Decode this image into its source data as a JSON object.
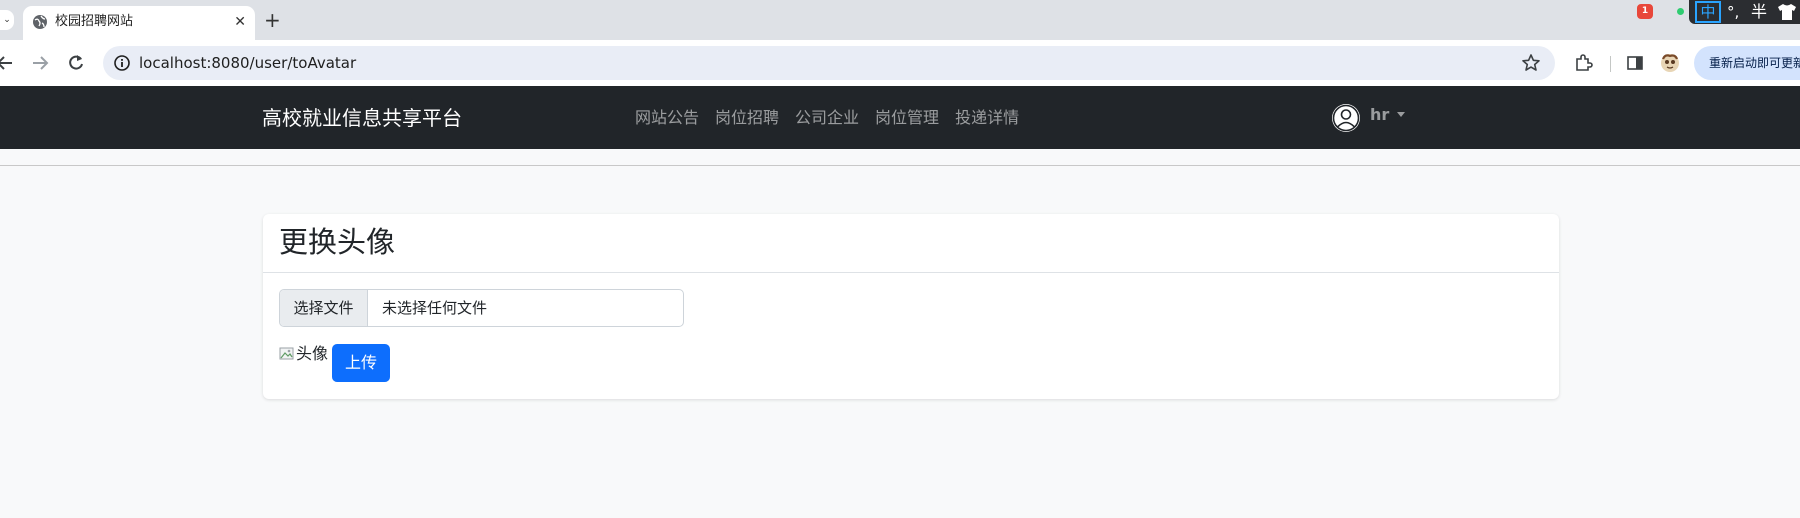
{
  "browser": {
    "tab_menu_glyph": "⌄",
    "tab": {
      "title": "校园招聘网站",
      "favicon": "globe-icon",
      "close_glyph": "✕"
    },
    "new_tab_glyph": "+",
    "tray": {
      "badge": "1",
      "ime_mode": "中",
      "ime_punct": "°,",
      "ime_width": "半",
      "skin": "shirt-icon"
    },
    "url": "localhost:8080/user/toAvatar",
    "relaunch_label": "重新启动即可更新"
  },
  "navbar": {
    "brand": "高校就业信息共享平台",
    "links": [
      "网站公告",
      "岗位招聘",
      "公司企业",
      "岗位管理",
      "投递详情"
    ],
    "username": "hr"
  },
  "card": {
    "title": "更换头像",
    "file_button": "选择文件",
    "file_status": "未选择任何文件",
    "image_alt": "头像",
    "upload_button": "上传"
  },
  "colors": {
    "navbar_bg": "#212529",
    "primary": "#0d6efd",
    "page_bg": "#f8f9fa",
    "relaunch_bg": "#d3e3fd"
  }
}
